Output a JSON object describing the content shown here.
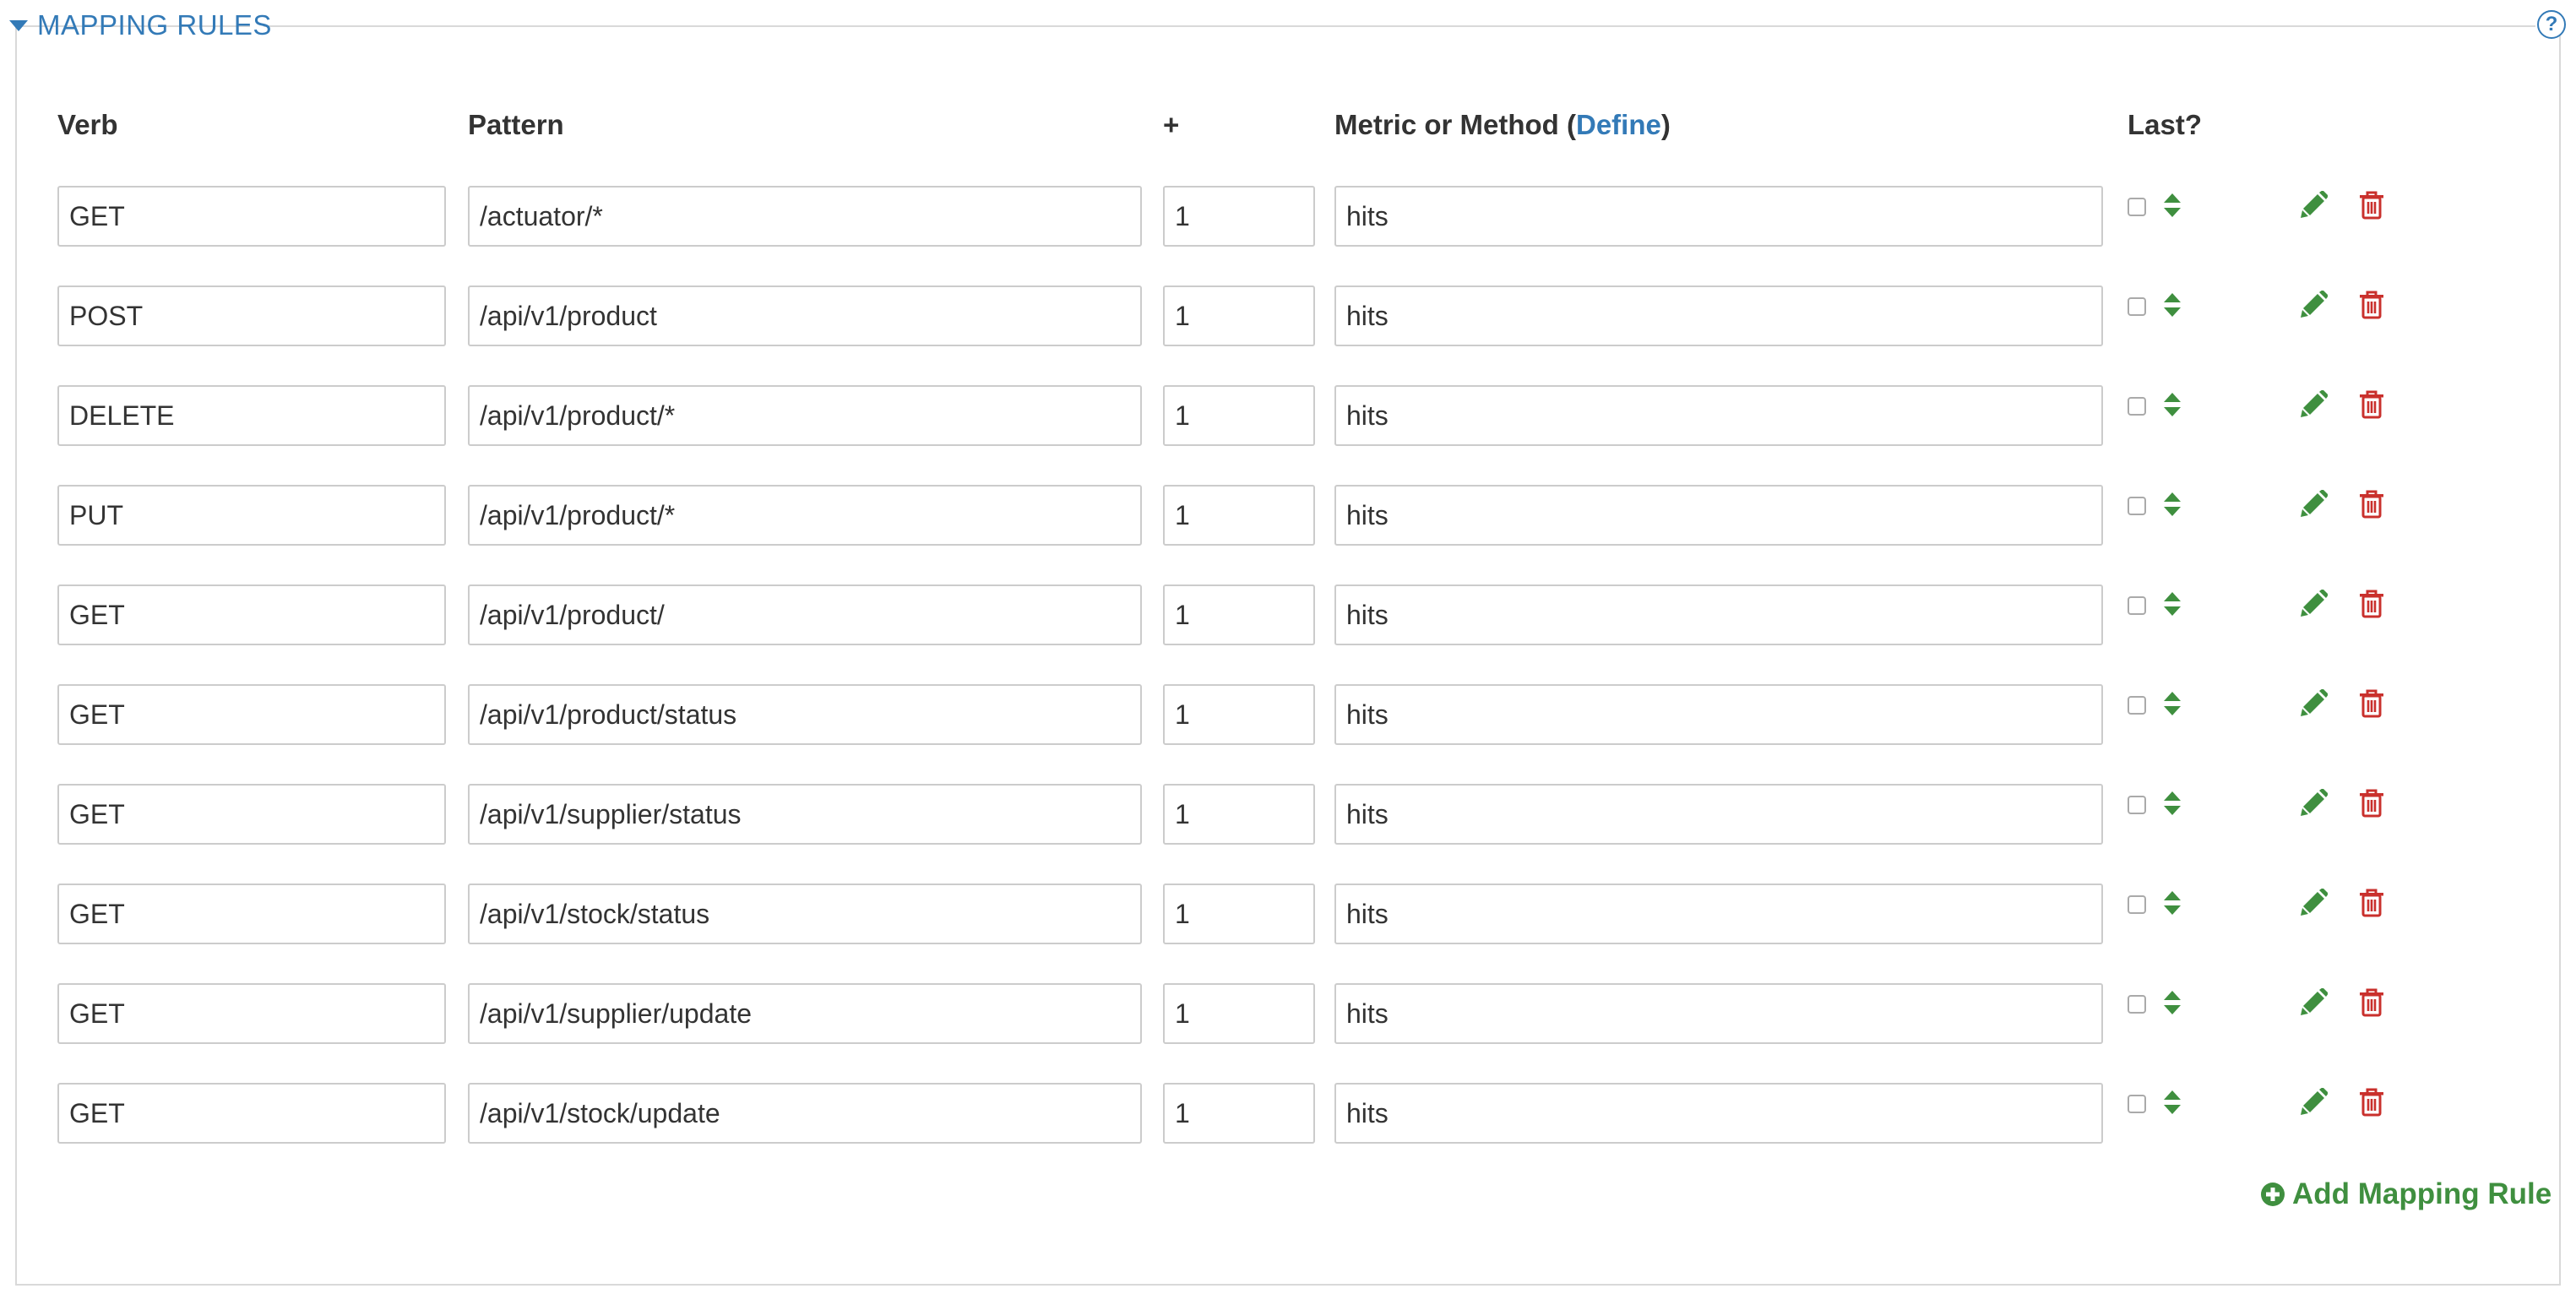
{
  "section": {
    "title": "MAPPING RULES",
    "help": "?"
  },
  "headers": {
    "verb": "Verb",
    "pattern": "Pattern",
    "delta": "+",
    "metric_prefix": "Metric or Method (",
    "metric_link": "Define",
    "metric_suffix": ")",
    "last": "Last?"
  },
  "rules": [
    {
      "verb": "GET",
      "pattern": "/actuator/*",
      "delta": "1",
      "metric": "hits",
      "last": false
    },
    {
      "verb": "POST",
      "pattern": "/api/v1/product",
      "delta": "1",
      "metric": "hits",
      "last": false
    },
    {
      "verb": "DELETE",
      "pattern": "/api/v1/product/*",
      "delta": "1",
      "metric": "hits",
      "last": false
    },
    {
      "verb": "PUT",
      "pattern": "/api/v1/product/*",
      "delta": "1",
      "metric": "hits",
      "last": false
    },
    {
      "verb": "GET",
      "pattern": "/api/v1/product/",
      "delta": "1",
      "metric": "hits",
      "last": false
    },
    {
      "verb": "GET",
      "pattern": "/api/v1/product/status",
      "delta": "1",
      "metric": "hits",
      "last": false
    },
    {
      "verb": "GET",
      "pattern": "/api/v1/supplier/status",
      "delta": "1",
      "metric": "hits",
      "last": false
    },
    {
      "verb": "GET",
      "pattern": "/api/v1/stock/status",
      "delta": "1",
      "metric": "hits",
      "last": false
    },
    {
      "verb": "GET",
      "pattern": "/api/v1/supplier/update",
      "delta": "1",
      "metric": "hits",
      "last": false
    },
    {
      "verb": "GET",
      "pattern": "/api/v1/stock/update",
      "delta": "1",
      "metric": "hits",
      "last": false
    }
  ],
  "add_rule_label": "Add Mapping Rule",
  "icons": {
    "legend": "caret-down-icon",
    "help": "question-circle-icon",
    "sort": "sort-icon",
    "edit": "pencil-icon",
    "delete": "trash-icon",
    "add": "plus-circle-icon"
  },
  "colors": {
    "link": "#337ab7",
    "action_green": "#3f8f3f",
    "delete_red": "#c9302c",
    "border": "#cccccc"
  }
}
